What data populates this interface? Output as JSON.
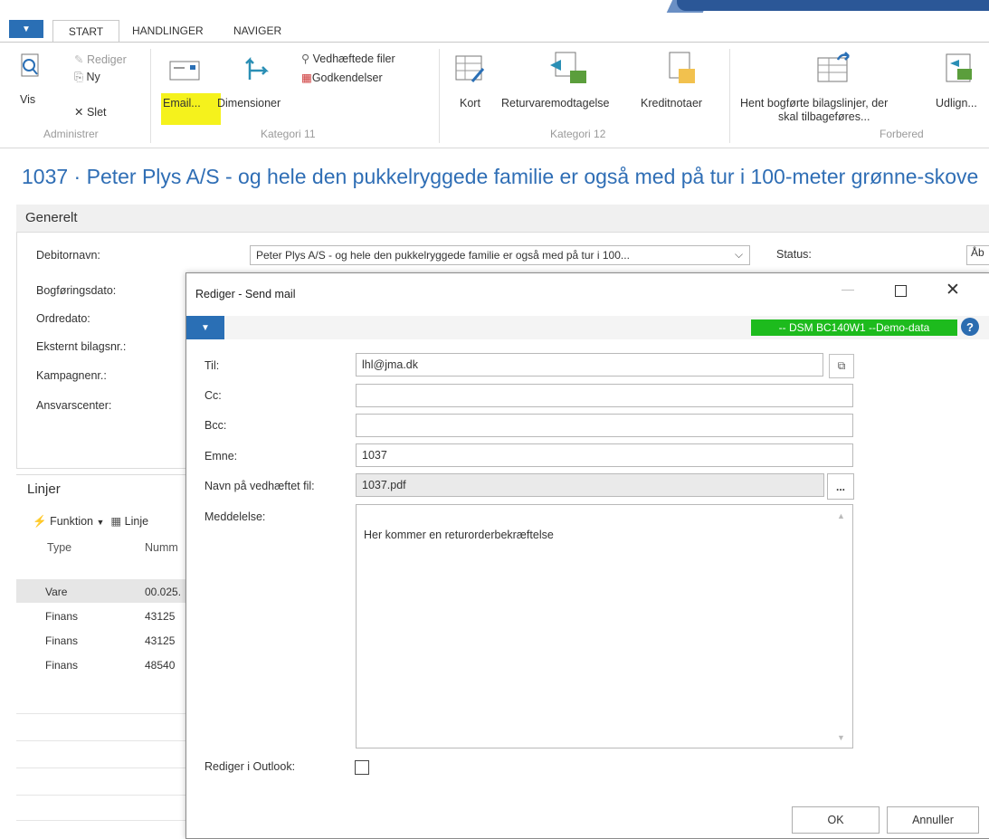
{
  "tabs": {
    "start": "START",
    "handlinger": "HANDLINGER",
    "naviger": "NAVIGER"
  },
  "ribbon": {
    "vis": "Vis",
    "rediger": "Rediger",
    "ny": "Ny",
    "slet": "Slet",
    "group_administrer": "Administrer",
    "email": "Email...",
    "dimensioner": "Dimensioner",
    "vedhaeftede": "Vedhæftede filer",
    "godkendelser": "Godkendelser",
    "group_kategori11": "Kategori 11",
    "kort": "Kort",
    "returvaremodtagelse": "Returvaremodtagelse",
    "kreditnotaer": "Kreditnotaer",
    "group_kategori12": "Kategori 12",
    "hent_line1": "Hent bogførte bilagslinjer, der",
    "hent_line2": "skal tilbageføres...",
    "udlign": "Udlign...",
    "group_forbered": "Forbered"
  },
  "page_title": "1037 · Peter Plys A/S - og hele den pukkelryggede familie er også med på tur i 100-meter grønne-skove",
  "general": {
    "title": "Generelt",
    "debitornavn_label": "Debitornavn:",
    "debitornavn_value": "Peter Plys A/S - og hele den pukkelryggede familie er også med på tur i 100...",
    "status_label": "Status:",
    "status_value": "Åb",
    "bogfoeringsdato_label": "Bogføringsdato:",
    "ordredato_label": "Ordredato:",
    "eksternt_label": "Eksternt bilagsnr.:",
    "kampagnenr_label": "Kampagnenr.:",
    "ansvarscenter_label": "Ansvarscenter:"
  },
  "lines": {
    "title": "Linjer",
    "funktion": "Funktion",
    "linjer_btn": "Linje",
    "col_type": "Type",
    "col_nummer": "Numm",
    "rows": [
      {
        "type": "Vare",
        "nummer": "00.025."
      },
      {
        "type": "Finans",
        "nummer": "43125"
      },
      {
        "type": "Finans",
        "nummer": "43125"
      },
      {
        "type": "Finans",
        "nummer": "48540"
      }
    ]
  },
  "dialog": {
    "title": "Rediger - Send mail",
    "badge": "-- DSM BC140W1 --Demo-data",
    "til_label": "Til:",
    "til_value": "lhl@jma.dk",
    "cc_label": "Cc:",
    "cc_value": "",
    "bcc_label": "Bcc:",
    "bcc_value": "",
    "emne_label": "Emne:",
    "emne_value": "1037",
    "attachment_label": "Navn på vedhæftet fil:",
    "attachment_value": "1037.pdf",
    "attachment_btn": "...",
    "message_label": "Meddelelse:",
    "message_value": "Her kommer en returorderbekræftelse",
    "outlook_label": "Rediger i Outlook:",
    "outlook_checked": false,
    "ok": "OK",
    "cancel": "Annuller"
  },
  "colors": {
    "accent": "#2a6fb5",
    "title_blue": "#2f6eb5",
    "badge_green": "#1dbb1d",
    "highlight": "#f5f21c"
  }
}
